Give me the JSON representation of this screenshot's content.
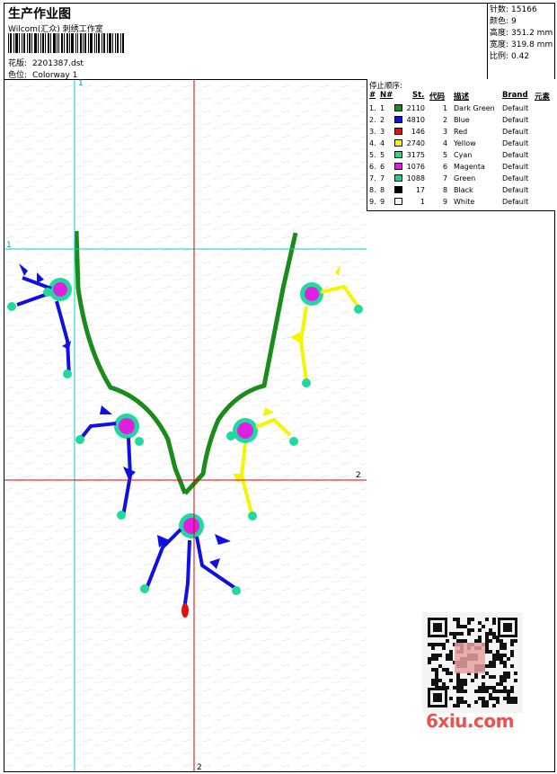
{
  "header": {
    "title": "生产作业图",
    "company": "Wilcom(汇众) 刺绣工作室",
    "design_label": "花版:",
    "design_value": "2201387.dst",
    "colorway_label": "色位:",
    "colorway_value": "Colorway 1"
  },
  "stats": [
    {
      "label": "针数:",
      "value": "15166"
    },
    {
      "label": "颜色:",
      "value": "9"
    },
    {
      "label": "高度:",
      "value": "351.2 mm"
    },
    {
      "label": "宽度:",
      "value": "319.8 mm"
    },
    {
      "label": "比例:",
      "value": "0.42"
    }
  ],
  "stop_table": {
    "caption": "停止顺序:",
    "headers": {
      "num": "#",
      "n": "N#",
      "st": "St.",
      "code": "代码",
      "desc": "描述",
      "brand": "Brand",
      "elem": "元素"
    },
    "rows": [
      {
        "num": "1.",
        "n": "1",
        "color": "#1a8c1a",
        "st": "2110",
        "code": "1",
        "desc": "Dark Green",
        "brand": "Default"
      },
      {
        "num": "2.",
        "n": "2",
        "color": "#1010e0",
        "st": "4810",
        "code": "2",
        "desc": "Blue",
        "brand": "Default"
      },
      {
        "num": "3.",
        "n": "3",
        "color": "#e01010",
        "st": "146",
        "code": "3",
        "desc": "Red",
        "brand": "Default"
      },
      {
        "num": "4.",
        "n": "4",
        "color": "#f5f500",
        "st": "2740",
        "code": "4",
        "desc": "Yellow",
        "brand": "Default"
      },
      {
        "num": "5.",
        "n": "5",
        "color": "#20d8a0",
        "st": "3175",
        "code": "5",
        "desc": "Cyan",
        "brand": "Default"
      },
      {
        "num": "6.",
        "n": "6",
        "color": "#e020e0",
        "st": "1076",
        "code": "6",
        "desc": "Magenta",
        "brand": "Default"
      },
      {
        "num": "7.",
        "n": "7",
        "color": "#20d090",
        "st": "1088",
        "code": "7",
        "desc": "Green",
        "brand": "Default"
      },
      {
        "num": "8.",
        "n": "8",
        "color": "#000000",
        "st": "17",
        "code": "8",
        "desc": "Black",
        "brand": "Default"
      },
      {
        "num": "9.",
        "n": "9",
        "color": "#ffffff",
        "st": "1",
        "code": "9",
        "desc": "White",
        "brand": "Default"
      }
    ]
  },
  "guides": {
    "v1": "1",
    "h1": "1",
    "h2": "2",
    "v2": "2"
  },
  "watermark": "6xiu.com",
  "colors": {
    "green": "#1a8c1a",
    "blue": "#1010e0",
    "yellow": "#f5f500",
    "cyan": "#20d8a0",
    "magenta": "#e020e0",
    "red": "#e01010",
    "guide_cyan": "#00d0d0",
    "guide_red": "#e00000"
  }
}
